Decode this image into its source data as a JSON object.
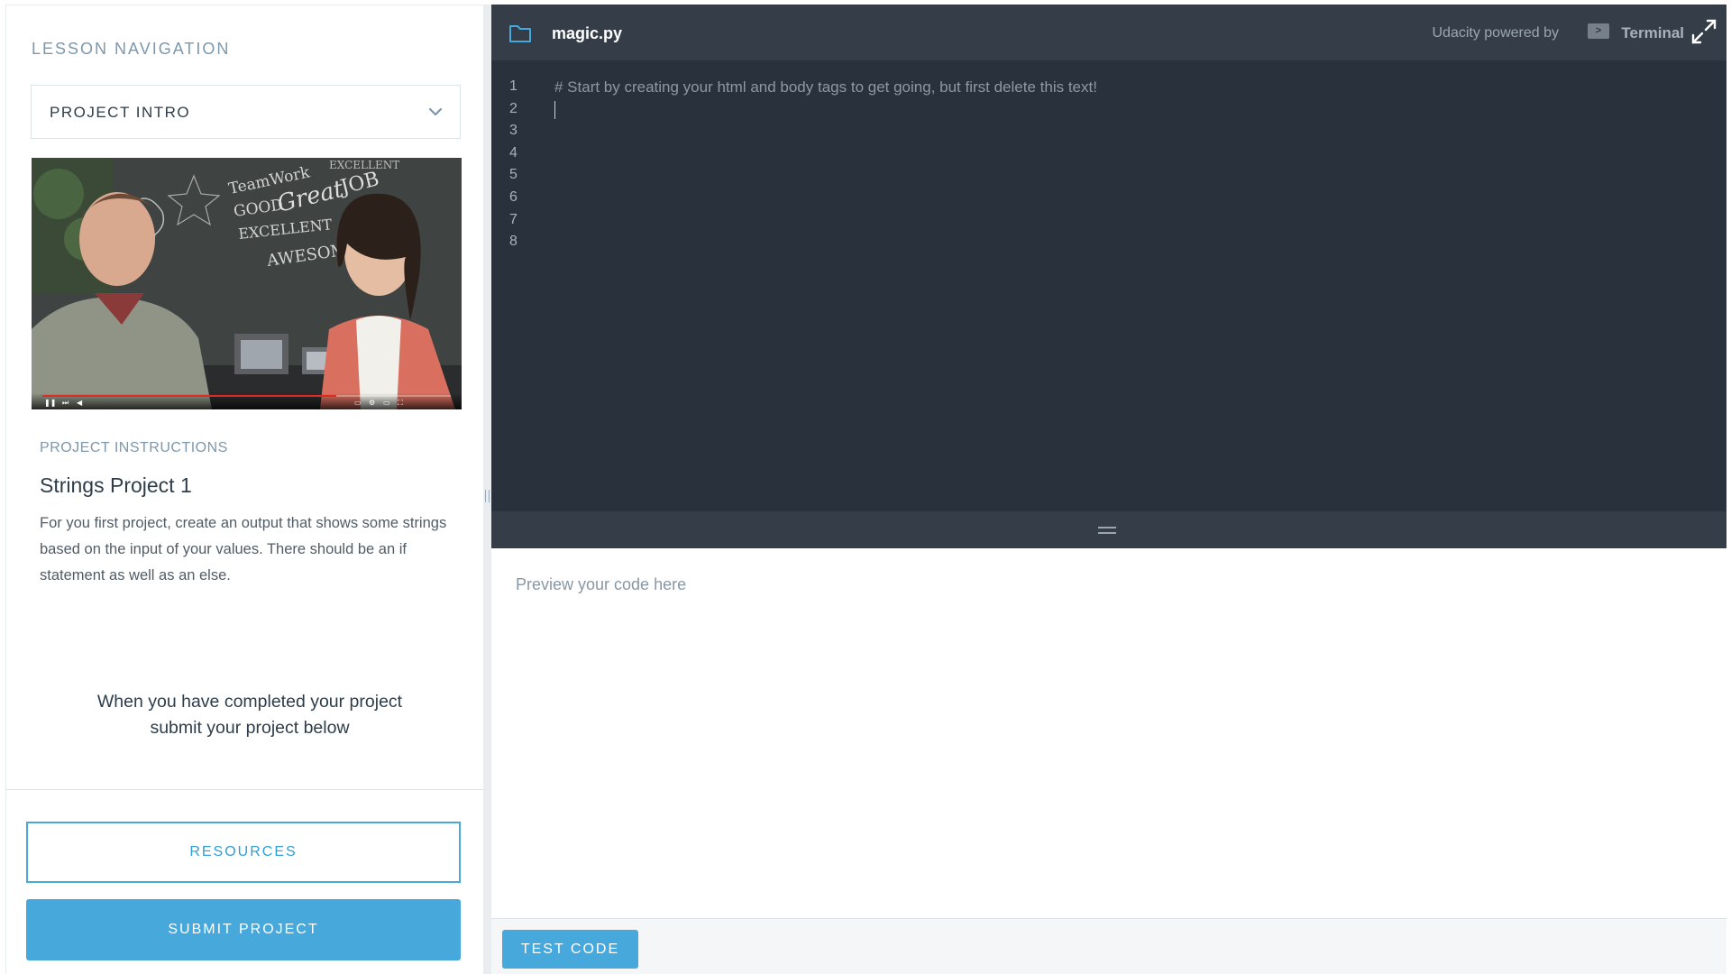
{
  "sidebar": {
    "nav_heading": "LESSON NAVIGATION",
    "lesson_select_value": "PROJECT INTRO",
    "instructions_heading": "PROJECT INSTRUCTIONS",
    "project_title": "Strings Project 1",
    "project_description": "For you first project, create an output that shows some strings based on the input of your values. There should be an if statement as well as an else.",
    "completed_note_line1": "When you have completed your project",
    "completed_note_line2": "submit your project below",
    "resources_label": "RESOURCES",
    "submit_label": "SUBMIT PROJECT"
  },
  "video": {
    "chalkboard_words": [
      "TeamWork",
      "GOOD",
      "Great",
      "JOB",
      "EXCELLENT",
      "AWESOME",
      "EXCELLENT"
    ],
    "progress": 0.72
  },
  "editor": {
    "file_name": "magic.py",
    "powered_by": "Udacity powered by",
    "terminal_badge": ">",
    "terminal_label": "Terminal",
    "line_numbers": [
      "1",
      "2",
      "3",
      "4",
      "5",
      "6",
      "7",
      "8"
    ],
    "code_lines": [
      "# Start by creating your html and body tags to get going, but first delete this text!",
      "",
      "",
      "",
      "",
      "",
      "",
      ""
    ]
  },
  "preview": {
    "placeholder": "Preview your code here",
    "test_label": "TEST CODE"
  },
  "colors": {
    "accent": "#47a8dc",
    "editor_bg": "#29313c",
    "editor_header_bg": "#353e48",
    "muted_heading": "#7d97ad"
  }
}
